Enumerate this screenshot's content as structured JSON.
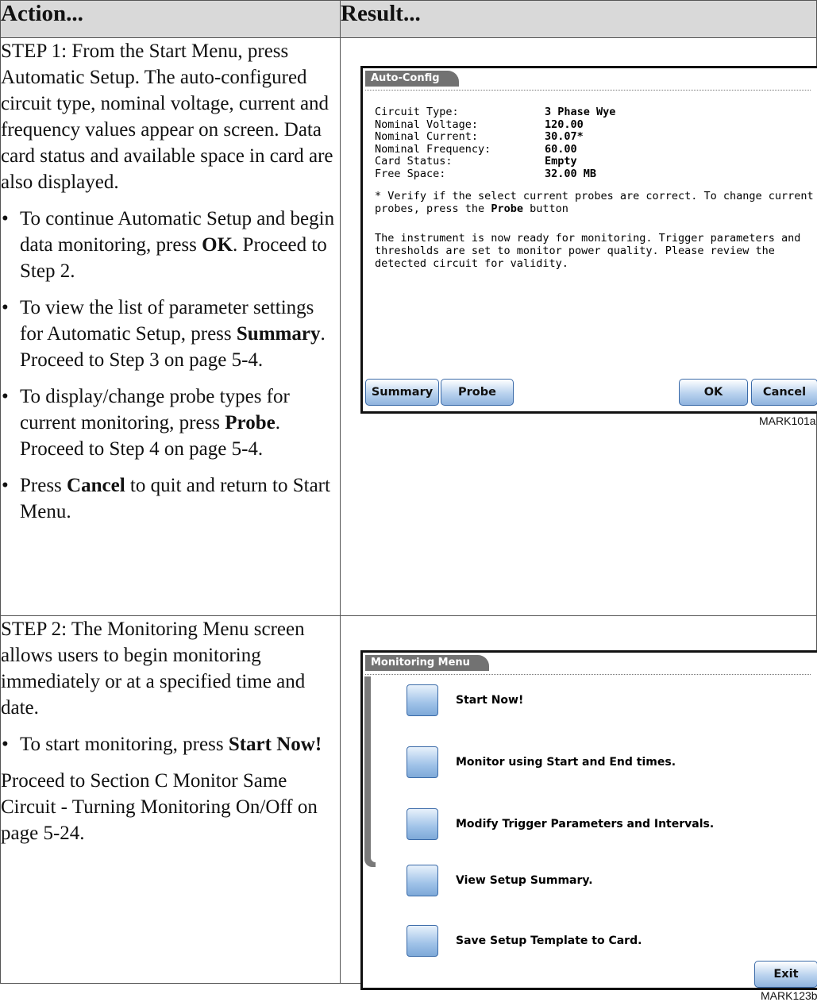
{
  "headers": {
    "action": "Action...",
    "result": "Result..."
  },
  "step1": {
    "intro": "STEP 1: From the Start Menu, press Automatic Setup. The auto-configured circuit type, nominal voltage, current and frequency values appear on screen. Data card status and available space in card are also displayed.",
    "bullets": [
      {
        "pre": "To continue Automatic Setup and begin data monitoring, press ",
        "bold": "OK",
        "post": ". Proceed to Step 2."
      },
      {
        "pre": "To view the list of parameter settings for Automatic Setup, press ",
        "bold": "Summary",
        "post": ". Proceed to Step 3 on page 5-4."
      },
      {
        "pre": "To display/change probe types for current monitoring, press ",
        "bold": "Probe",
        "post": ". Proceed to Step 4 on page 5-4."
      },
      {
        "pre": "Press ",
        "bold": "Cancel",
        "post": " to quit and return to Start Menu."
      }
    ]
  },
  "step2": {
    "intro": "STEP 2: The Monitoring Menu screen allows users to begin monitoring immediately or at a specified time and date.",
    "bullets": [
      {
        "pre": "To start monitoring, press ",
        "bold": "Start Now!",
        "post": ""
      }
    ],
    "outro": "Proceed to Section C Monitor Same Circuit - Turning Monitoring On/Off on page 5-24."
  },
  "screen1": {
    "tab": "Auto-Config",
    "fields": [
      {
        "label": "Circuit Type:",
        "value": "3 Phase Wye"
      },
      {
        "label": "Nominal Voltage:",
        "value": "120.00"
      },
      {
        "label": "Nominal Current:",
        "value": "30.07*"
      },
      {
        "label": "Nominal Frequency:",
        "value": "60.00"
      },
      {
        "label": "Card Status:",
        "value": "Empty"
      },
      {
        "label": "Free Space:",
        "value": "32.00 MB"
      }
    ],
    "note_pre": "* Verify if the select current probes are correct. To change current probes, press the ",
    "note_bold": "Probe",
    "note_post": " button",
    "ready": "The instrument is now ready for monitoring. Trigger parameters and thresholds are set to monitor power quality. Please review the detected circuit for validity.",
    "buttons": {
      "summary": "Summary",
      "probe": "Probe",
      "ok": "OK",
      "cancel": "Cancel"
    },
    "caption": "MARK101a"
  },
  "screen2": {
    "tab": "Monitoring Menu",
    "items": [
      "Start Now!",
      "Monitor using Start and End times.",
      "Modify Trigger Parameters and Intervals.",
      "View Setup Summary.",
      "Save Setup Template to Card."
    ],
    "exit": "Exit",
    "caption": "MARK123b"
  },
  "colors": {
    "header_bg": "#d9d9d9",
    "tab_bg": "#727272",
    "button_blue": "#9fc2e8"
  }
}
